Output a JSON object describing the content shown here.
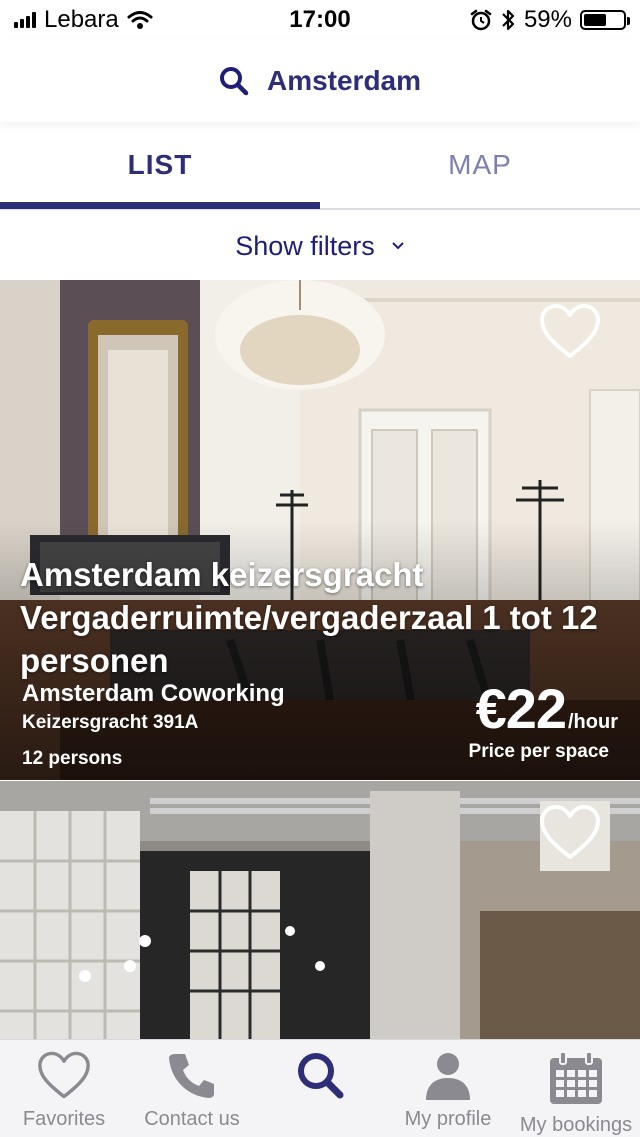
{
  "status_bar": {
    "carrier": "Lebara",
    "time": "17:00",
    "battery_percent": "59%",
    "battery_level": 0.59
  },
  "header": {
    "search_title": "Amsterdam",
    "icon": "search-icon"
  },
  "tabs": [
    {
      "label": "LIST",
      "active": true
    },
    {
      "label": "MAP",
      "active": false
    }
  ],
  "filters": {
    "label": "Show filters",
    "icon": "chevron-down-icon"
  },
  "listings": [
    {
      "title": "Amsterdam keizersgracht Vergaderruimte/vergaderzaal 1 tot 12 personen",
      "provider": "Amsterdam Coworking",
      "address": "Keizersgracht 391A",
      "capacity": "12 persons",
      "price": "€22",
      "price_unit": "/hour",
      "price_note": "Price per space",
      "favorite_icon": "heart-outline-icon"
    },
    {
      "favorite_icon": "heart-outline-icon"
    }
  ],
  "bottom_nav": [
    {
      "label": "Favorites",
      "icon": "heart-icon"
    },
    {
      "label": "Contact us",
      "icon": "phone-icon"
    },
    {
      "label": "",
      "icon": "search-icon"
    },
    {
      "label": "My profile",
      "icon": "user-icon"
    },
    {
      "label": "My bookings",
      "icon": "calendar-icon"
    }
  ],
  "colors": {
    "primary": "#2e2e78",
    "tab_inactive": "#7d7fb0",
    "nav_gray": "#8a8a90",
    "nav_background": "#f4f4f6"
  }
}
